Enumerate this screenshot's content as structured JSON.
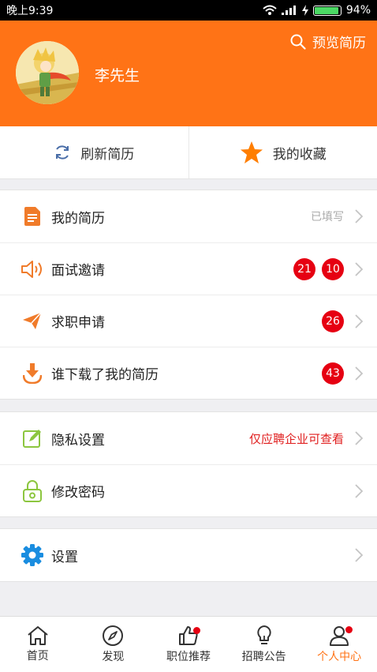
{
  "status_bar": {
    "time": "晚上9:39",
    "battery": "94%"
  },
  "header": {
    "preview_label": "预览简历",
    "username": "李先生",
    "bg_color": "#ff7316"
  },
  "quick_actions": {
    "refresh_label": "刷新简历",
    "favorites_label": "我的收藏"
  },
  "menu": {
    "resume": {
      "label": "我的简历",
      "status": "已填写"
    },
    "interview": {
      "label": "面试邀请",
      "badge1": "21",
      "badge2": "10"
    },
    "applications": {
      "label": "求职申请",
      "badge": "26"
    },
    "downloads": {
      "label": "谁下载了我的简历",
      "badge": "43"
    },
    "privacy": {
      "label": "隐私设置",
      "value": "仅应聘企业可查看"
    },
    "password": {
      "label": "修改密码"
    },
    "settings": {
      "label": "设置"
    }
  },
  "tabbar": {
    "home": "首页",
    "discover": "发现",
    "jobs": "职位推荐",
    "announcements": "招聘公告",
    "profile": "个人中心"
  }
}
